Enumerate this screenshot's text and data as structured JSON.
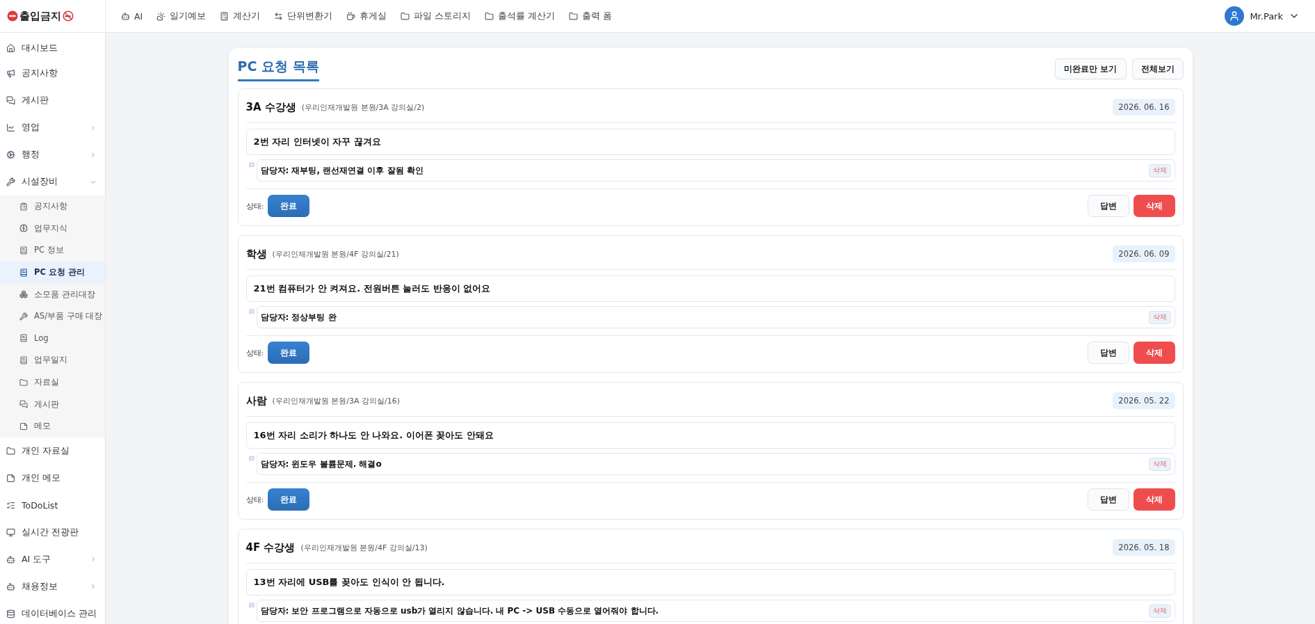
{
  "logo": {
    "text": "출입금지"
  },
  "nav": [
    {
      "label": "AI"
    },
    {
      "label": "일기예보"
    },
    {
      "label": "계산기"
    },
    {
      "label": "단위변환기"
    },
    {
      "label": "휴게실"
    },
    {
      "label": "파일 스토리지"
    },
    {
      "label": "출석률 계산기"
    },
    {
      "label": "출력 폼"
    }
  ],
  "user": {
    "name": "Mr.Park"
  },
  "sidebar": {
    "items": [
      {
        "label": "대시보드"
      },
      {
        "label": "공지사항"
      },
      {
        "label": "게시판"
      },
      {
        "label": "영업",
        "expanded": false
      },
      {
        "label": "행정",
        "expanded": false
      },
      {
        "label": "시설장비",
        "expanded": true,
        "children": [
          {
            "label": "공지사항",
            "selected": false
          },
          {
            "label": "업무지식",
            "selected": false
          },
          {
            "label": "PC 정보",
            "selected": false
          },
          {
            "label": "PC 요청 관리",
            "selected": true
          },
          {
            "label": "소모품 관리대장",
            "selected": false
          },
          {
            "label": "AS/부품 구매 대장",
            "selected": false
          },
          {
            "label": "Log",
            "selected": false
          },
          {
            "label": "업무일지",
            "selected": false
          },
          {
            "label": "자료실",
            "selected": false
          },
          {
            "label": "게시판",
            "selected": false
          },
          {
            "label": "메모",
            "selected": false
          }
        ]
      },
      {
        "label": "개인 자료실"
      },
      {
        "label": "개인 메모"
      },
      {
        "label": "ToDoList"
      },
      {
        "label": "실시간 전광판"
      },
      {
        "label": "AI 도구",
        "expanded": false
      },
      {
        "label": "채용정보",
        "expanded": false
      },
      {
        "label": "데이터베이스 관리"
      }
    ]
  },
  "page": {
    "title": "PC 요청 목록",
    "filters": [
      "미완료만 보기",
      "전체보기"
    ]
  },
  "requests": [
    {
      "requester": "3A 수강생",
      "location": "(우리인재개발원 본원/3A 강의실/2)",
      "date": "2026. 06. 16",
      "message": "2번 자리 인터넷이 자꾸 끊겨요",
      "reply": "담당자: 재부팅, 랜선재연결 이후 잘됨 확인",
      "reply_delete": "삭제",
      "status_label": "상태:",
      "status": "완료",
      "buttons": [
        "답변",
        "삭제"
      ]
    },
    {
      "requester": "학생",
      "location": "(우리인재개발원 본원/4F 강의실/21)",
      "date": "2026. 06. 09",
      "message": "21번 컴퓨터가 안 켜져요. 전원버튼 눌러도 반응이 없어요",
      "reply": "담당자: 정상부팅 완",
      "reply_delete": "삭제",
      "status_label": "상태:",
      "status": "완료",
      "buttons": [
        "답변",
        "삭제"
      ]
    },
    {
      "requester": "사람",
      "location": "(우리인재개발원 본원/3A 강의실/16)",
      "date": "2026. 05. 22",
      "message": "16번 자리 소리가 하나도 안 나와요. 이어폰 꽂아도 안돼요",
      "reply": "담당자: 윈도우 볼륨문제. 해결o",
      "reply_delete": "삭제",
      "status_label": "상태:",
      "status": "완료",
      "buttons": [
        "답변",
        "삭제"
      ]
    },
    {
      "requester": "4F 수강생",
      "location": "(우리인재개발원 본원/4F 강의실/13)",
      "date": "2026. 05. 18",
      "message": "13번 자리에 USB를 꽂아도 인식이 안 됩니다.",
      "reply": "담당자: 보안 프로그램으로 자동으로 usb가 열리지 않습니다. 내 PC -> USB 수동으로 열어줘야 합니다.",
      "reply_delete": "삭제"
    }
  ]
}
